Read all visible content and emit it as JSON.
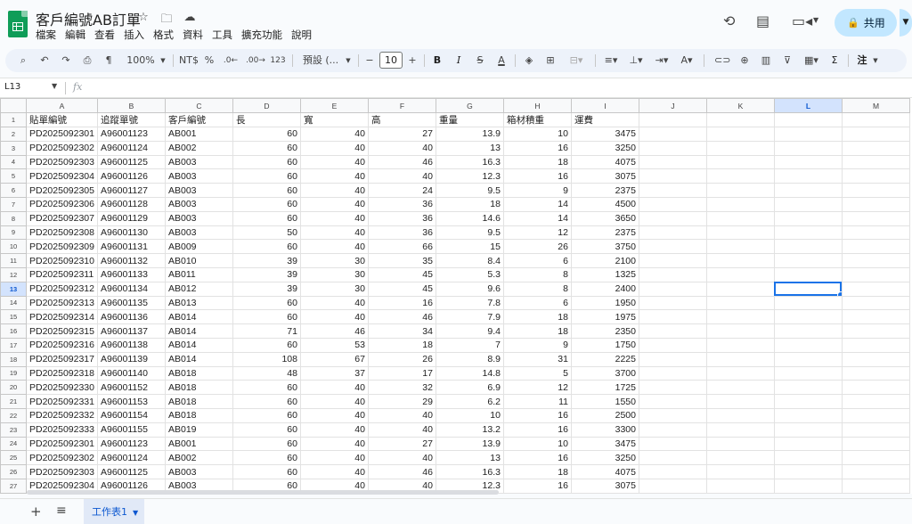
{
  "app": {
    "title": "客戶編號AB訂單",
    "menus": [
      "檔案",
      "編輯",
      "查看",
      "插入",
      "格式",
      "資料",
      "工具",
      "擴充功能",
      "說明"
    ],
    "share_label": "共用"
  },
  "toolbar": {
    "zoom": "100%",
    "currency": "NT$",
    "percent": "%",
    "dec_decrease": ".0←",
    "dec_increase": ".00→",
    "number_format": "123",
    "font_name": "預設 (...",
    "font_size": "10",
    "bold": "B",
    "italic": "I",
    "strike": "S",
    "text_color": "A",
    "sum": "Σ",
    "kanji": "注"
  },
  "formula_bar": {
    "cell_ref": "L13",
    "fx": "fx"
  },
  "columns": [
    "A",
    "B",
    "C",
    "D",
    "E",
    "F",
    "G",
    "H",
    "I",
    "J",
    "K",
    "L",
    "M"
  ],
  "active_cell": {
    "col": "L",
    "row": 13
  },
  "headers": [
    "貼單編號",
    "追蹤單號",
    "客戶編號",
    "長",
    "寬",
    "高",
    "重量",
    "箱材積重",
    "運費"
  ],
  "rows": [
    [
      "PD2025092301",
      "A96001123",
      "AB001",
      "60",
      "40",
      "27",
      "13.9",
      "10",
      "3475"
    ],
    [
      "PD2025092302",
      "A96001124",
      "AB002",
      "60",
      "40",
      "40",
      "13",
      "16",
      "3250"
    ],
    [
      "PD2025092303",
      "A96001125",
      "AB003",
      "60",
      "40",
      "46",
      "16.3",
      "18",
      "4075"
    ],
    [
      "PD2025092304",
      "A96001126",
      "AB003",
      "60",
      "40",
      "40",
      "12.3",
      "16",
      "3075"
    ],
    [
      "PD2025092305",
      "A96001127",
      "AB003",
      "60",
      "40",
      "24",
      "9.5",
      "9",
      "2375"
    ],
    [
      "PD2025092306",
      "A96001128",
      "AB003",
      "60",
      "40",
      "36",
      "18",
      "14",
      "4500"
    ],
    [
      "PD2025092307",
      "A96001129",
      "AB003",
      "60",
      "40",
      "36",
      "14.6",
      "14",
      "3650"
    ],
    [
      "PD2025092308",
      "A96001130",
      "AB003",
      "50",
      "40",
      "36",
      "9.5",
      "12",
      "2375"
    ],
    [
      "PD2025092309",
      "A96001131",
      "AB009",
      "60",
      "40",
      "66",
      "15",
      "26",
      "3750"
    ],
    [
      "PD2025092310",
      "A96001132",
      "AB010",
      "39",
      "30",
      "35",
      "8.4",
      "6",
      "2100"
    ],
    [
      "PD2025092311",
      "A96001133",
      "AB011",
      "39",
      "30",
      "45",
      "5.3",
      "8",
      "1325"
    ],
    [
      "PD2025092312",
      "A96001134",
      "AB012",
      "39",
      "30",
      "45",
      "9.6",
      "8",
      "2400"
    ],
    [
      "PD2025092313",
      "A96001135",
      "AB013",
      "60",
      "40",
      "16",
      "7.8",
      "6",
      "1950"
    ],
    [
      "PD2025092314",
      "A96001136",
      "AB014",
      "60",
      "40",
      "46",
      "7.9",
      "18",
      "1975"
    ],
    [
      "PD2025092315",
      "A96001137",
      "AB014",
      "71",
      "46",
      "34",
      "9.4",
      "18",
      "2350"
    ],
    [
      "PD2025092316",
      "A96001138",
      "AB014",
      "60",
      "53",
      "18",
      "7",
      "9",
      "1750"
    ],
    [
      "PD2025092317",
      "A96001139",
      "AB014",
      "108",
      "67",
      "26",
      "8.9",
      "31",
      "2225"
    ],
    [
      "PD2025092318",
      "A96001140",
      "AB018",
      "48",
      "37",
      "17",
      "14.8",
      "5",
      "3700"
    ],
    [
      "PD2025092330",
      "A96001152",
      "AB018",
      "60",
      "40",
      "32",
      "6.9",
      "12",
      "1725"
    ],
    [
      "PD2025092331",
      "A96001153",
      "AB018",
      "60",
      "40",
      "29",
      "6.2",
      "11",
      "1550"
    ],
    [
      "PD2025092332",
      "A96001154",
      "AB018",
      "60",
      "40",
      "40",
      "10",
      "16",
      "2500"
    ],
    [
      "PD2025092333",
      "A96001155",
      "AB019",
      "60",
      "40",
      "40",
      "13.2",
      "16",
      "3300"
    ],
    [
      "PD2025092301",
      "A96001123",
      "AB001",
      "60",
      "40",
      "27",
      "13.9",
      "10",
      "3475"
    ],
    [
      "PD2025092302",
      "A96001124",
      "AB002",
      "60",
      "40",
      "40",
      "13",
      "16",
      "3250"
    ],
    [
      "PD2025092303",
      "A96001125",
      "AB003",
      "60",
      "40",
      "46",
      "16.3",
      "18",
      "4075"
    ],
    [
      "PD2025092304",
      "A96001126",
      "AB003",
      "60",
      "40",
      "40",
      "12.3",
      "16",
      "3075"
    ]
  ],
  "sheet_tab": "工作表1",
  "colors": {
    "accent": "#1a73e8",
    "share_bg": "#c2e7ff",
    "logo": "#0f9d58",
    "active_header_bg": "#d3e3fd"
  },
  "icons": [
    "star-icon",
    "move-folder-icon",
    "cloud-status-icon",
    "history-icon",
    "comment-icon",
    "meet-icon",
    "lock-icon",
    "search-icon",
    "undo-icon",
    "redo-icon",
    "print-icon",
    "paint-format-icon",
    "fill-color-icon",
    "borders-icon",
    "merge-icon",
    "align-icon",
    "valign-icon",
    "wrap-icon",
    "rotate-icon",
    "link-icon",
    "add-comment-icon",
    "chart-icon",
    "filter-icon",
    "filter-views-icon",
    "add-sheet-icon",
    "all-sheets-icon"
  ]
}
